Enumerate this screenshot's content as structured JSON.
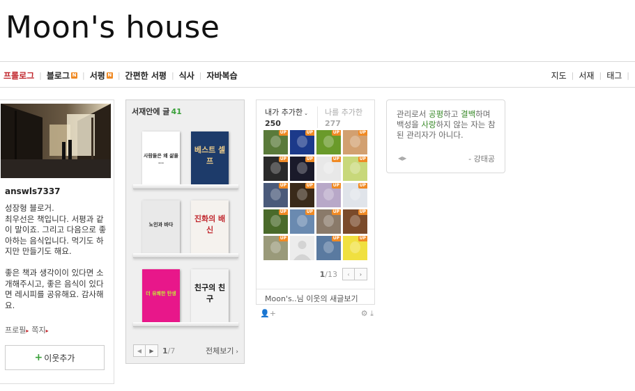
{
  "site": {
    "title": "Moon's house"
  },
  "nav": {
    "left": [
      {
        "label": "프롤로그",
        "active": true,
        "badge": false
      },
      {
        "label": "블로그",
        "active": false,
        "badge": true
      },
      {
        "label": "서평",
        "active": false,
        "badge": true
      },
      {
        "label": "간편한 서평",
        "active": false,
        "badge": false
      },
      {
        "label": "식사",
        "active": false,
        "badge": false
      },
      {
        "label": "자바복습",
        "active": false,
        "badge": false
      }
    ],
    "right": [
      "지도",
      "서재",
      "태그"
    ],
    "badge_text": "N"
  },
  "profile": {
    "id": "answls7337",
    "intro": "성장형 블로거.\n최우선은 책입니다. 서평과 같이 말이죠. 그리고 다음으로 좋아하는 음식입니다. 먹기도 하지만 만들기도 해요.\n\n좋은 책과 생각이이 있다면 소개해주시고, 좋은 음식이 있다면 레시피를 공유해요. 감사해요.",
    "link_profile": "프로필",
    "link_message": "쪽지",
    "add_neighbor_label": "이웃추가"
  },
  "shelf": {
    "title": "서재안에 글",
    "count": "41",
    "books": [
      {
        "title": "사람들은 왜 삶을 ...",
        "bg": "#ffffff",
        "fg": "#333"
      },
      {
        "title": "베스트 셀프",
        "bg": "#1d3b6a",
        "fg": "#e8c98a"
      },
      {
        "title": "노인과 바다",
        "bg": "#e9e9e9",
        "fg": "#222"
      },
      {
        "title": "진화의 배신",
        "bg": "#f5f2ee",
        "fg": "#c0262c"
      },
      {
        "title": "더 유쾌한 탄생",
        "bg": "#e8178a",
        "fg": "#c6e63a"
      },
      {
        "title": "친구의 친구",
        "bg": "#f2f2f2",
        "fg": "#111"
      }
    ],
    "page_current": "1",
    "page_total": "/7",
    "view_all": "전체보기"
  },
  "neighbors": {
    "tab_added": "내가 추가한",
    "tab_added_count": "250",
    "tab_me": "나를 추가한",
    "tab_me_count": "277",
    "up_label": "UP",
    "avatars": [
      {
        "color": "#5a7a3a",
        "up": true
      },
      {
        "color": "#1c3a8a",
        "up": true
      },
      {
        "color": "#6a9a2a",
        "up": true
      },
      {
        "color": "#d2a070",
        "up": true
      },
      {
        "color": "#2a2a2a",
        "up": true
      },
      {
        "color": "#1a1a2a",
        "up": true
      },
      {
        "color": "#e8e8e8",
        "up": true
      },
      {
        "color": "#c8d87a",
        "up": true
      },
      {
        "color": "#4a5a7a",
        "up": true
      },
      {
        "color": "#3a2a1a",
        "up": true
      },
      {
        "color": "#b8a8c8",
        "up": true
      },
      {
        "color": "#e0e4ea",
        "up": true
      },
      {
        "color": "#4a6a2a",
        "up": true
      },
      {
        "color": "#6a8ab0",
        "up": true
      },
      {
        "color": "#8a7a6a",
        "up": true
      },
      {
        "color": "#7a4a2a",
        "up": true
      },
      {
        "color": "#9a9a7a",
        "up": true
      },
      {
        "color": "#e6e6e6",
        "up": false
      },
      {
        "color": "#5a7aa0",
        "up": true
      },
      {
        "color": "#f0e040",
        "up": true
      }
    ],
    "page_current": "1",
    "page_total": "/13",
    "footer": "Moon's..님 이웃의 새글보기"
  },
  "quote": {
    "parts": [
      {
        "text": "관리로서 ",
        "g": false
      },
      {
        "text": "공평",
        "g": true
      },
      {
        "text": "하고 ",
        "g": false
      },
      {
        "text": "결백",
        "g": true
      },
      {
        "text": "하며 백성을 ",
        "g": false
      },
      {
        "text": "사랑",
        "g": true
      },
      {
        "text": "하지 않는 자는 참된 관리자가 아니다.",
        "g": false
      }
    ],
    "author": "- 강태공"
  }
}
